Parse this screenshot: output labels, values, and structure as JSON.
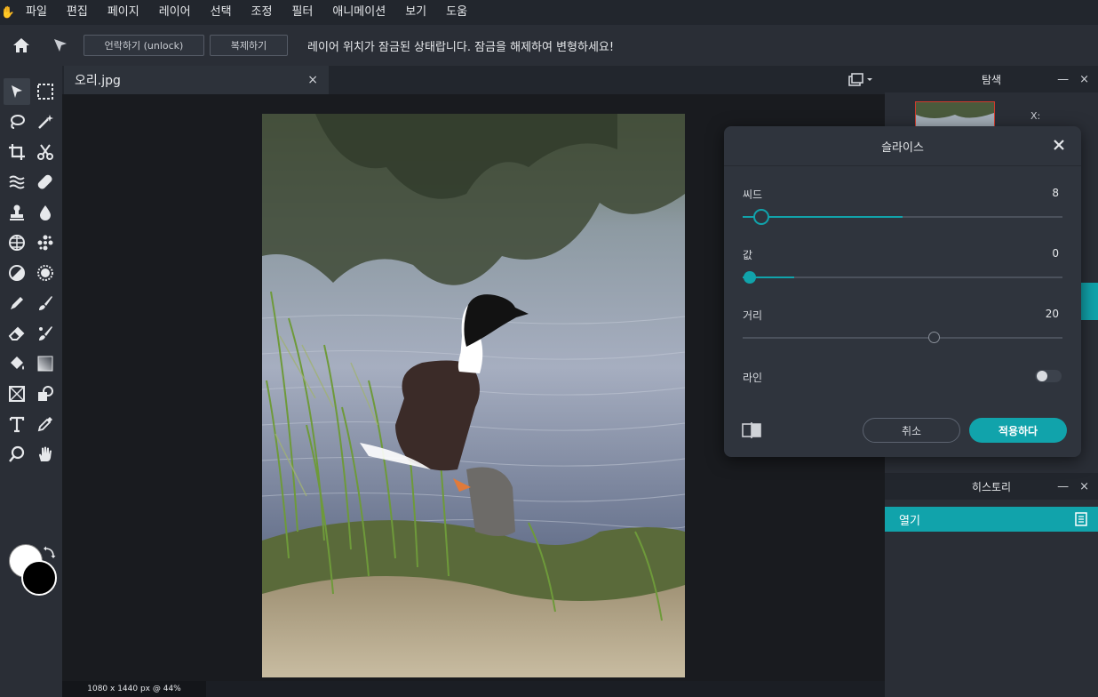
{
  "menu": [
    "파일",
    "편집",
    "페이지",
    "레이어",
    "선택",
    "조정",
    "필터",
    "애니메이션",
    "보기",
    "도움"
  ],
  "toolbar": {
    "unlock_label": "언락하기 (unlock)",
    "duplicate_label": "복제하기",
    "message": "레이어 위치가 잠금된 상태랍니다. 잠금을 해제하여 변형하세요!"
  },
  "document": {
    "tab_title": "오리.jpg",
    "close_glyph": "×",
    "status": "1080 x 1440 px @ 44%"
  },
  "navigator": {
    "title": "탐색",
    "x_label": "X:",
    "minimize_glyph": "—",
    "close_glyph": "×"
  },
  "history": {
    "title": "히스토리",
    "item": "열기",
    "minimize_glyph": "—",
    "close_glyph": "×"
  },
  "dialog": {
    "title": "슬라이스",
    "seed_label": "씨드",
    "seed_value": "8",
    "seed_position": 0.06,
    "value_label": "값",
    "value_value": "0",
    "value_position": 0.02,
    "distance_label": "거리",
    "distance_value": "20",
    "distance_position": 0.6,
    "line_label": "라인",
    "line_enabled": false,
    "cancel_label": "취소",
    "apply_label": "적용하다"
  },
  "colors": {
    "accent": "#11a3ab",
    "foreground": "#ffffff",
    "background": "#000000"
  }
}
